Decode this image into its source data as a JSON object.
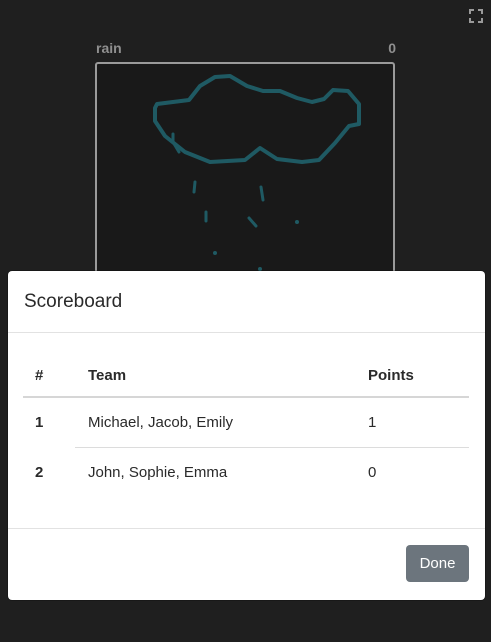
{
  "game": {
    "word": "rain",
    "score": "0"
  },
  "icons": {
    "fullscreen": "fullscreen-icon"
  },
  "colors": {
    "drawing_stroke": "#1f5a63",
    "done_button": "#6c757d"
  },
  "scoreboard": {
    "title": "Scoreboard",
    "columns": {
      "rank": "#",
      "team": "Team",
      "points": "Points"
    },
    "rows": [
      {
        "rank": "1",
        "team": "Michael, Jacob, Emily",
        "points": "1"
      },
      {
        "rank": "2",
        "team": "John, Sophie, Emma",
        "points": "0"
      }
    ],
    "done_label": "Done"
  }
}
